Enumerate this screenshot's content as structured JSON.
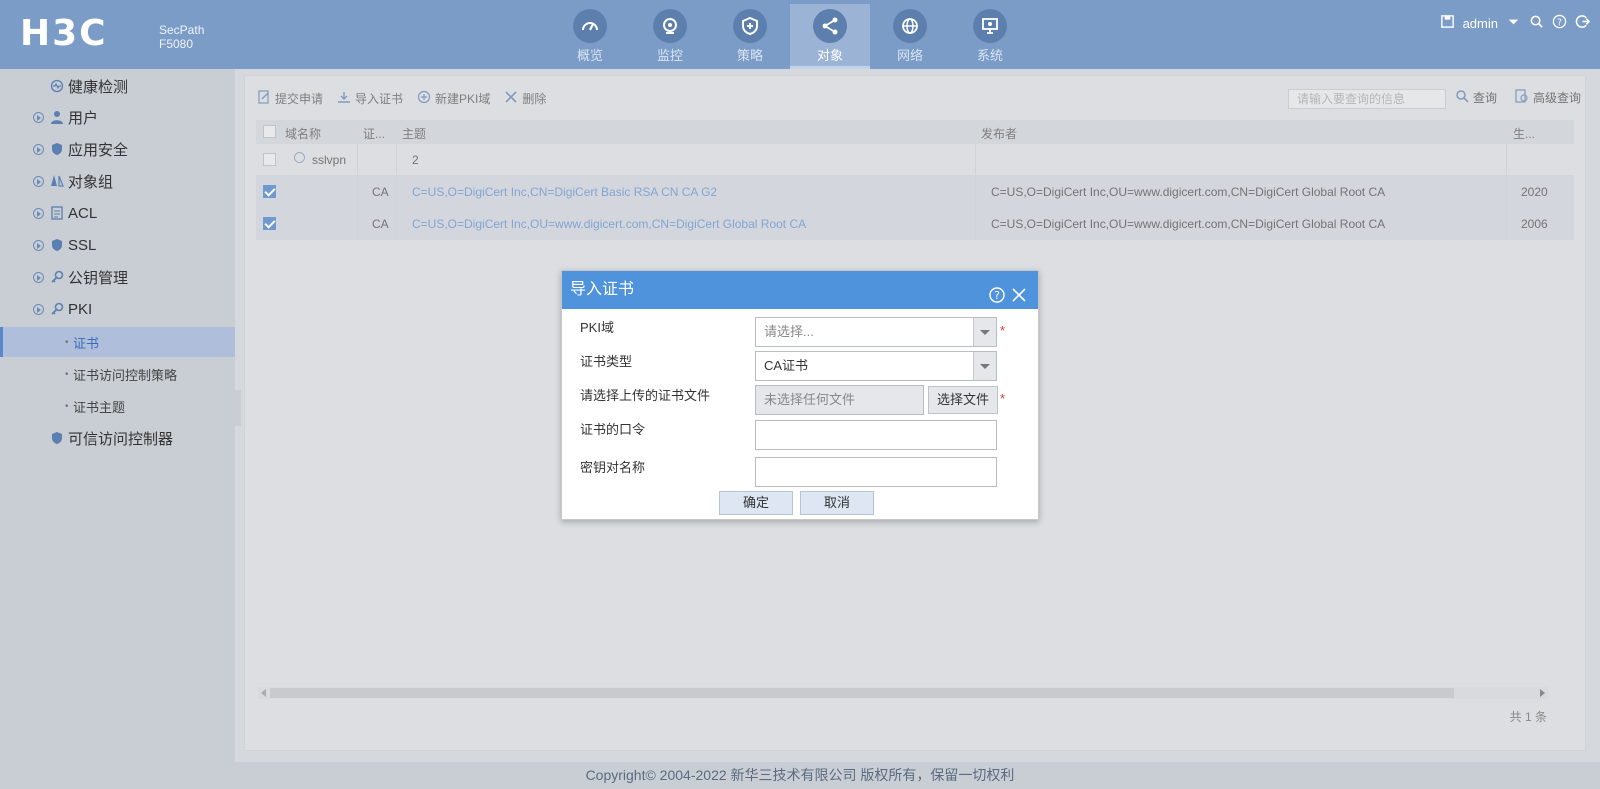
{
  "header": {
    "logo_text": "H3C",
    "product_line": "SecPath",
    "product_model": "F5080",
    "nav": [
      {
        "label": "概览",
        "icon": "gauge-icon"
      },
      {
        "label": "监控",
        "icon": "camera-icon"
      },
      {
        "label": "策略",
        "icon": "shield-plus-icon"
      },
      {
        "label": "对象",
        "icon": "share-icon",
        "active": true
      },
      {
        "label": "网络",
        "icon": "globe-icon"
      },
      {
        "label": "系统",
        "icon": "monitor-gear-icon"
      }
    ],
    "user": "admin"
  },
  "sidebar": {
    "items": [
      {
        "label": "健康检测"
      },
      {
        "label": "用户"
      },
      {
        "label": "应用安全"
      },
      {
        "label": "对象组"
      },
      {
        "label": "ACL"
      },
      {
        "label": "SSL"
      },
      {
        "label": "公钥管理"
      },
      {
        "label": "PKI"
      },
      {
        "label": "可信访问控制器"
      }
    ],
    "sub_items": [
      {
        "label": "证书",
        "active": true
      },
      {
        "label": "证书访问控制策略"
      },
      {
        "label": "证书主题"
      }
    ]
  },
  "toolbar": {
    "submit_request": "提交申请",
    "import_cert": "导入证书",
    "new_pki_domain": "新建PKI域",
    "delete": "删除",
    "search_placeholder": "请输入要查询的信息",
    "search": "查询",
    "advanced_search": "高级查询"
  },
  "grid": {
    "headers": {
      "domain": "域名称",
      "cert": "证...",
      "subject": "主题",
      "issuer": "发布者",
      "effective": "生..."
    },
    "group": {
      "name": "sslvpn",
      "count": "2"
    },
    "rows": [
      {
        "checked": true,
        "cert": "CA",
        "subject": "C=US,O=DigiCert Inc,CN=DigiCert Basic RSA CN CA G2",
        "issuer": "C=US,O=DigiCert Inc,OU=www.digicert.com,CN=DigiCert Global Root CA",
        "effective": "2020"
      },
      {
        "checked": true,
        "cert": "CA",
        "subject": "C=US,O=DigiCert Inc,OU=www.digicert.com,CN=DigiCert Global Root CA",
        "issuer": "C=US,O=DigiCert Inc,OU=www.digicert.com,CN=DigiCert Global Root CA",
        "effective": "2006"
      }
    ],
    "total": "共 1 条"
  },
  "dialog": {
    "title": "导入证书",
    "pki_domain_label": "PKI域",
    "pki_domain_placeholder": "请选择...",
    "cert_type_label": "证书类型",
    "cert_type_value": "CA证书",
    "file_label": "请选择上传的证书文件",
    "file_value": "未选择任何文件",
    "choose_file": "选择文件",
    "password_label": "证书的口令",
    "keypair_label": "密钥对名称",
    "required_mark": "*",
    "ok": "确定",
    "cancel": "取消"
  },
  "footer": {
    "copyright": "Copyright© 2004-2022 新华三技术有限公司 版权所有，保留一切权利"
  },
  "colors": {
    "header": "#7b9cc7",
    "dialog_title": "#4f93dc",
    "link": "#4a7fc4"
  }
}
